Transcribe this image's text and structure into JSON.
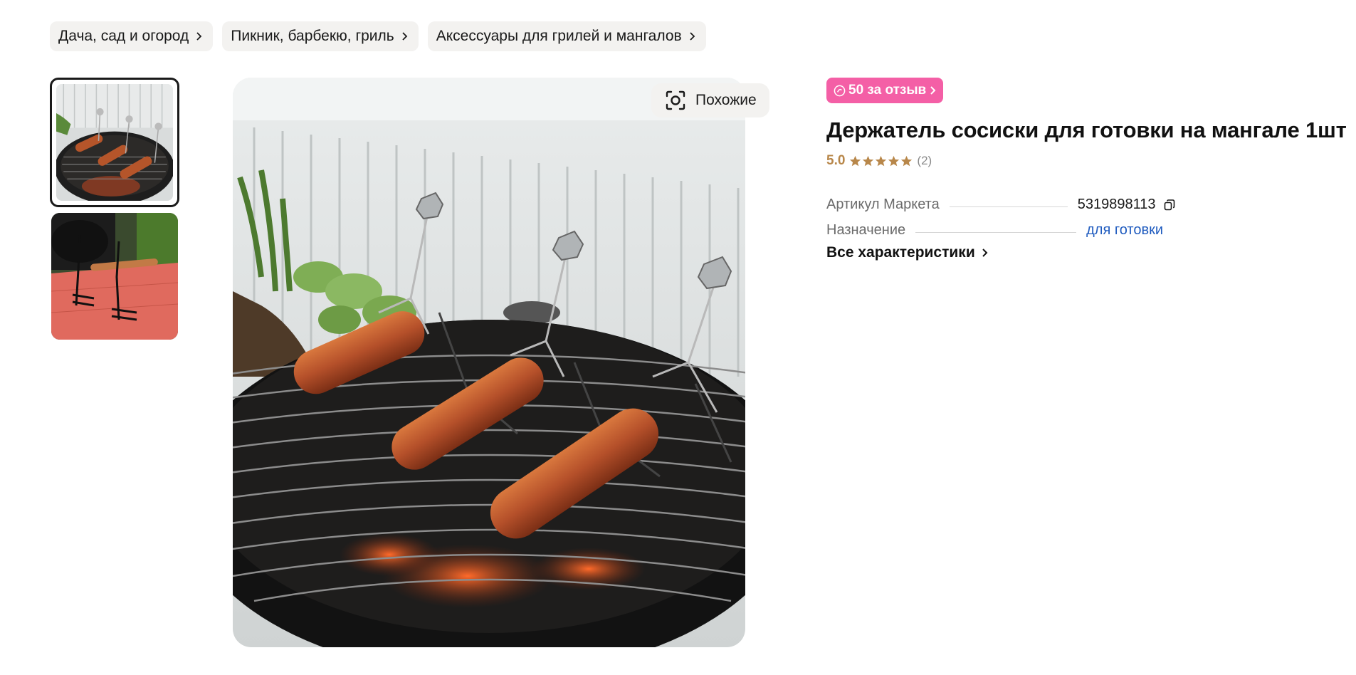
{
  "breadcrumbs": [
    {
      "label": "Дача, сад и огород"
    },
    {
      "label": "Пикник, барбекю, гриль"
    },
    {
      "label": "Аксессуары для грилей и мангалов"
    }
  ],
  "gallery": {
    "similar_label": "Похожие",
    "thumbnail_count": 2,
    "active_index": 0
  },
  "product": {
    "badge": "50 за отзыв",
    "title": "Держатель сосиски для готовки на мангале 1шт",
    "rating": "5.0",
    "stars": 5,
    "reviews": "(2)",
    "specs": [
      {
        "label": "Артикул Маркета",
        "value": "5319898113"
      },
      {
        "label": "Назначение",
        "value": "для готовки"
      }
    ],
    "all_specs_label": "Все характеристики"
  },
  "colors": {
    "badge_bg": "#f45fa6",
    "rating": "#b8874a",
    "link": "#1f5bbf",
    "chip_bg": "#f3f2f0"
  },
  "icons": [
    "chevron-right-icon",
    "similar-search-icon",
    "coin-icon",
    "star-icon",
    "copy-icon"
  ]
}
